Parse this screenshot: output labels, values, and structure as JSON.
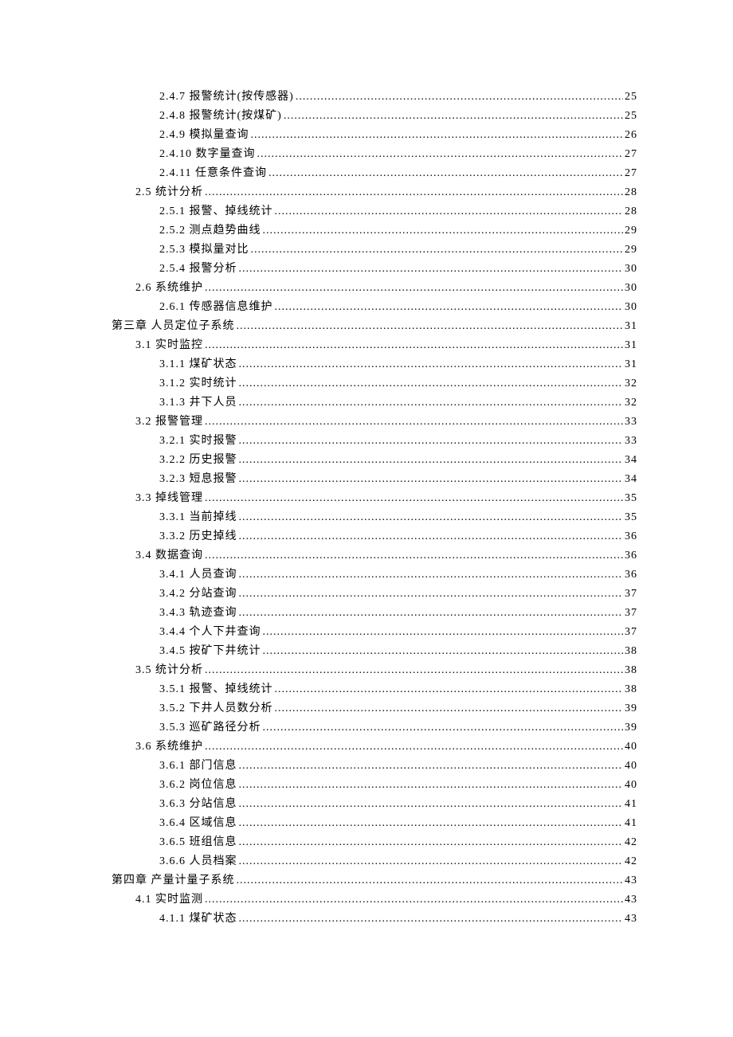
{
  "toc": [
    {
      "indent": 3,
      "label": "2.4.7 报警统计(按传感器)",
      "page": "25"
    },
    {
      "indent": 3,
      "label": "2.4.8 报警统计(按煤矿)",
      "page": "25"
    },
    {
      "indent": 3,
      "label": "2.4.9 模拟量查询",
      "page": "26"
    },
    {
      "indent": 3,
      "label": "2.4.10 数字量查询",
      "page": "27"
    },
    {
      "indent": 3,
      "label": "2.4.11 任意条件查询",
      "page": "27"
    },
    {
      "indent": 2,
      "label": "2.5 统计分析",
      "page": "28"
    },
    {
      "indent": 3,
      "label": "2.5.1 报警、掉线统计",
      "page": "28"
    },
    {
      "indent": 3,
      "label": "2.5.2 测点趋势曲线",
      "page": "29"
    },
    {
      "indent": 3,
      "label": "2.5.3 模拟量对比",
      "page": "29"
    },
    {
      "indent": 3,
      "label": "2.5.4 报警分析",
      "page": "30"
    },
    {
      "indent": 2,
      "label": "2.6 系统维护",
      "page": "30"
    },
    {
      "indent": 3,
      "label": "2.6.1 传感器信息维护",
      "page": "30"
    },
    {
      "indent": 1,
      "label": "第三章  人员定位子系统",
      "page": "31"
    },
    {
      "indent": 2,
      "label": "3.1 实时监控",
      "page": "31"
    },
    {
      "indent": 3,
      "label": "3.1.1 煤矿状态",
      "page": "31"
    },
    {
      "indent": 3,
      "label": "3.1.2 实时统计",
      "page": "32"
    },
    {
      "indent": 3,
      "label": "3.1.3 井下人员",
      "page": "32"
    },
    {
      "indent": 2,
      "label": "3.2 报警管理",
      "page": "33"
    },
    {
      "indent": 3,
      "label": "3.2.1 实时报警",
      "page": "33"
    },
    {
      "indent": 3,
      "label": "3.2.2 历史报警",
      "page": "34"
    },
    {
      "indent": 3,
      "label": "3.2.3 短息报警",
      "page": "34"
    },
    {
      "indent": 2,
      "label": "3.3 掉线管理",
      "page": "35"
    },
    {
      "indent": 3,
      "label": "3.3.1 当前掉线",
      "page": "35"
    },
    {
      "indent": 3,
      "label": "3.3.2 历史掉线",
      "page": "36"
    },
    {
      "indent": 2,
      "label": "3.4 数据查询",
      "page": "36"
    },
    {
      "indent": 3,
      "label": "3.4.1 人员查询",
      "page": "36"
    },
    {
      "indent": 3,
      "label": "3.4.2 分站查询",
      "page": "37"
    },
    {
      "indent": 3,
      "label": "3.4.3 轨迹查询",
      "page": "37"
    },
    {
      "indent": 3,
      "label": "3.4.4 个人下井查询",
      "page": "37"
    },
    {
      "indent": 3,
      "label": "3.4.5 按矿下井统计",
      "page": "38"
    },
    {
      "indent": 2,
      "label": "3.5 统计分析",
      "page": "38"
    },
    {
      "indent": 3,
      "label": "3.5.1 报警、掉线统计",
      "page": "38"
    },
    {
      "indent": 3,
      "label": "3.5.2 下井人员数分析",
      "page": "39"
    },
    {
      "indent": 3,
      "label": "3.5.3 巡矿路径分析",
      "page": "39"
    },
    {
      "indent": 2,
      "label": "3.6 系统维护",
      "page": "40"
    },
    {
      "indent": 3,
      "label": "3.6.1 部门信息",
      "page": "40"
    },
    {
      "indent": 3,
      "label": "3.6.2 岗位信息",
      "page": "40"
    },
    {
      "indent": 3,
      "label": "3.6.3 分站信息",
      "page": "41"
    },
    {
      "indent": 3,
      "label": "3.6.4 区域信息",
      "page": "41"
    },
    {
      "indent": 3,
      "label": "3.6.5 班组信息",
      "page": "42"
    },
    {
      "indent": 3,
      "label": "3.6.6 人员档案",
      "page": "42"
    },
    {
      "indent": 1,
      "label": "第四章  产量计量子系统",
      "page": "43"
    },
    {
      "indent": 2,
      "label": "4.1 实时监测",
      "page": "43"
    },
    {
      "indent": 3,
      "label": "4.1.1 煤矿状态",
      "page": "43"
    }
  ]
}
